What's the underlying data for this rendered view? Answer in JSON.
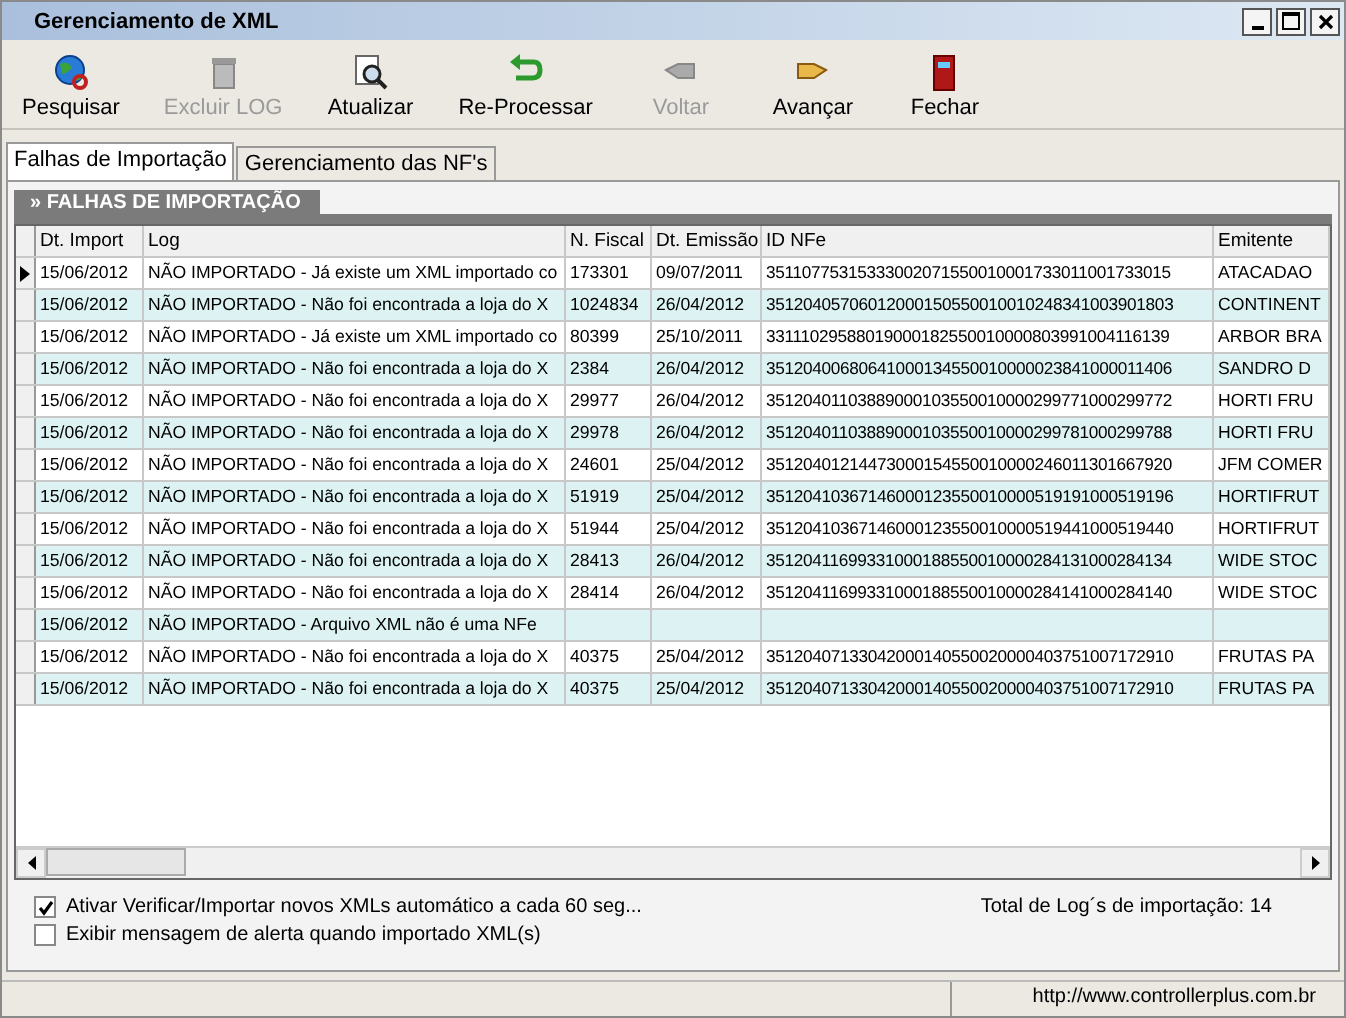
{
  "window": {
    "title": "Gerenciamento de XML"
  },
  "toolbar": [
    {
      "label": "Pesquisar",
      "disabled": false
    },
    {
      "label": "Excluir LOG",
      "disabled": true
    },
    {
      "label": "Atualizar",
      "disabled": false
    },
    {
      "label": "Re-Processar",
      "disabled": false
    },
    {
      "label": "Voltar",
      "disabled": true
    },
    {
      "label": "Avançar",
      "disabled": false
    },
    {
      "label": "Fechar",
      "disabled": false
    }
  ],
  "tabs": [
    {
      "label": "Falhas de Importação",
      "selected": true
    },
    {
      "label": "Gerenciamento das NF's",
      "selected": false
    }
  ],
  "panel": {
    "title": "» FALHAS DE IMPORTAÇÃO"
  },
  "table": {
    "columns": [
      "Dt. Import",
      "Log",
      "N. Fiscal",
      "Dt. Emissão",
      "ID NFe",
      "Emitente"
    ],
    "rows": [
      {
        "selected": true,
        "cells": [
          "15/06/2012",
          "NÃO IMPORTADO - Já existe um XML importado co",
          "173301",
          "09/07/2011",
          "35110775315333002071550010001733011001733015",
          "ATACADAO"
        ]
      },
      {
        "selected": false,
        "cells": [
          "15/06/2012",
          "NÃO IMPORTADO - Não foi encontrada a loja do X",
          "1024834",
          "26/04/2012",
          "35120405706012000150550010010248341003901803",
          "CONTINENT"
        ]
      },
      {
        "selected": false,
        "cells": [
          "15/06/2012",
          "NÃO IMPORTADO - Já existe um XML importado co",
          "80399",
          "25/10/2011",
          "33111029588019000182550010000803991004116139",
          "ARBOR BRA"
        ]
      },
      {
        "selected": false,
        "cells": [
          "15/06/2012",
          "NÃO IMPORTADO - Não foi encontrada a loja do X",
          "2384",
          "26/04/2012",
          "35120400680641000134550010000023841000011406",
          "SANDRO D"
        ]
      },
      {
        "selected": false,
        "cells": [
          "15/06/2012",
          "NÃO IMPORTADO - Não foi encontrada a loja do X",
          "29977",
          "26/04/2012",
          "35120401103889000103550010000299771000299772",
          "HORTI FRU"
        ]
      },
      {
        "selected": false,
        "cells": [
          "15/06/2012",
          "NÃO IMPORTADO - Não foi encontrada a loja do X",
          "29978",
          "26/04/2012",
          "35120401103889000103550010000299781000299788",
          "HORTI FRU"
        ]
      },
      {
        "selected": false,
        "cells": [
          "15/06/2012",
          "NÃO IMPORTADO - Não foi encontrada a loja do X",
          "24601",
          "25/04/2012",
          "35120401214473000154550010000246011301667920",
          "JFM COMER"
        ]
      },
      {
        "selected": false,
        "cells": [
          "15/06/2012",
          "NÃO IMPORTADO - Não foi encontrada a loja do X",
          "51919",
          "25/04/2012",
          "35120410367146000123550010000519191000519196",
          "HORTIFRUT"
        ]
      },
      {
        "selected": false,
        "cells": [
          "15/06/2012",
          "NÃO IMPORTADO - Não foi encontrada a loja do X",
          "51944",
          "25/04/2012",
          "35120410367146000123550010000519441000519440",
          "HORTIFRUT"
        ]
      },
      {
        "selected": false,
        "cells": [
          "15/06/2012",
          "NÃO IMPORTADO - Não foi encontrada a loja do X",
          "28413",
          "26/04/2012",
          "35120411699331000188550010000284131000284134",
          "WIDE STOC"
        ]
      },
      {
        "selected": false,
        "cells": [
          "15/06/2012",
          "NÃO IMPORTADO - Não foi encontrada a loja do X",
          "28414",
          "26/04/2012",
          "35120411699331000188550010000284141000284140",
          "WIDE STOC"
        ]
      },
      {
        "selected": false,
        "cells": [
          "15/06/2012",
          "NÃO IMPORTADO - Arquivo XML não é uma NFe"
        ]
      },
      {
        "selected": false,
        "cells": [
          "15/06/2012",
          "NÃO IMPORTADO - Não foi encontrada a loja do X",
          "40375",
          "25/04/2012",
          "35120407133042000140550020000403751007172910",
          "FRUTAS PA"
        ]
      },
      {
        "selected": false,
        "cells": [
          "15/06/2012",
          "NÃO IMPORTADO - Não foi encontrada a loja do X",
          "40375",
          "25/04/2012",
          "35120407133042000140550020000403751007172910",
          "FRUTAS PA"
        ]
      }
    ]
  },
  "options": [
    {
      "label": "Ativar Verificar/Importar novos XMLs automático a cada 60 seg...",
      "checked": true
    },
    {
      "label": "Exibir mensagem de alerta quando importado XML(s)",
      "checked": false
    }
  ],
  "total": "Total de Log´s de importação: 14",
  "status_bar": {
    "url": "http://www.controllerplus.com.br"
  }
}
